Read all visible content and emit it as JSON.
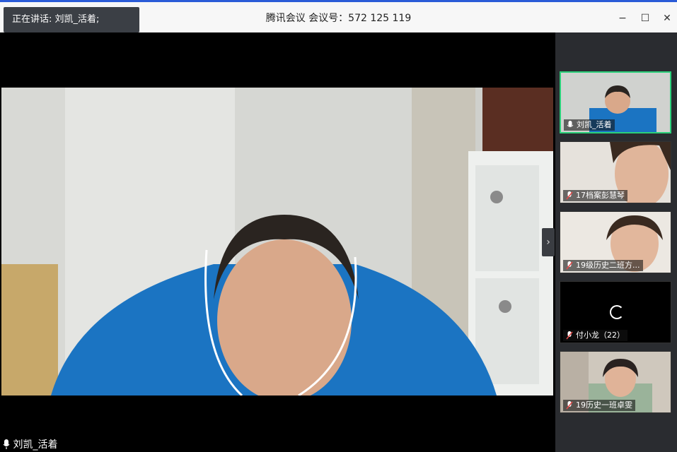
{
  "titlebar": {
    "speaking": "正在讲话: 刘凯_活着;",
    "title": "腾讯会议 会议号：572 125 119",
    "icons": {
      "minimize": "−",
      "maximize": "☐",
      "close": "✕"
    }
  },
  "main": {
    "speaker_name": "刘凯_活着"
  },
  "panel": {
    "collapse_icon": "›",
    "participants": [
      {
        "name": "刘凯_活着",
        "muted": false
      },
      {
        "name": "17档案彭慧琴",
        "muted": true
      },
      {
        "name": "19级历史二班方...",
        "muted": true
      },
      {
        "name": "付小龙（22）",
        "muted": true
      },
      {
        "name": "19历史一班卓雯",
        "muted": true
      }
    ]
  },
  "colors": {
    "accent": "#2bd07a",
    "titlebar_border": "#2a5bd7",
    "muted_icon": "#e84a4a"
  }
}
